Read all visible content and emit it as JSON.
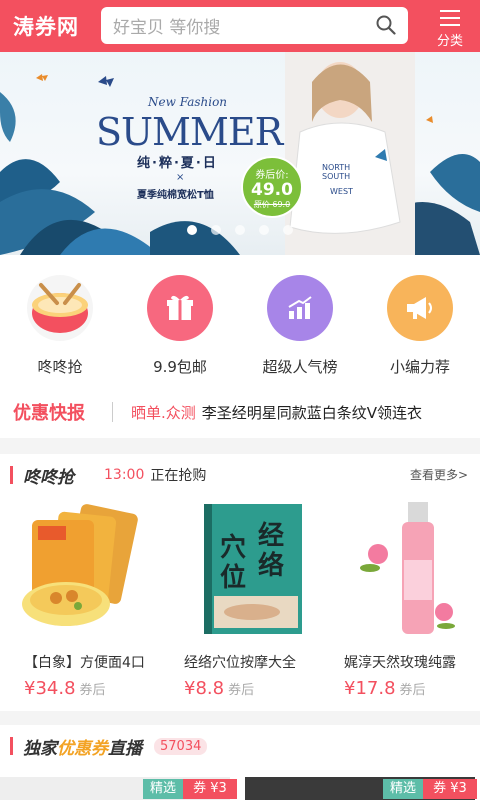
{
  "header": {
    "logo": "涛券网",
    "search_placeholder": "好宝贝 等你搜",
    "category_label": "分类"
  },
  "banner": {
    "new_fashion": "New Fashion",
    "summer": "SUMMER",
    "subtitle": "纯·粹·夏·日",
    "x_mark": "×",
    "description": "夏季纯棉宽松T恤",
    "badge_label": "券后价:",
    "badge_price": "49.0",
    "badge_original": "原价 69.0",
    "slide_count": 5,
    "active_slide": 0
  },
  "quick_links": [
    {
      "label": "咚咚抢",
      "icon": "drum-icon",
      "color": "#f5f5f5"
    },
    {
      "label": "9.9包邮",
      "icon": "gift-icon",
      "color": "#f7687f"
    },
    {
      "label": "超级人气榜",
      "icon": "chart-rise-icon",
      "color": "#a785e8"
    },
    {
      "label": "小编力荐",
      "icon": "megaphone-icon",
      "color": "#f8b45a"
    }
  ],
  "news": {
    "title": "优惠快报",
    "tag": "晒单.众测",
    "text": "李圣经明星同款蓝白条纹V领连衣"
  },
  "flash": {
    "title": "咚咚抢",
    "time": "13:00",
    "status": "正在抢购",
    "more": "查看更多>",
    "products": [
      {
        "name": "【白象】方便面4口",
        "price": "¥34.8",
        "after": "券后"
      },
      {
        "name": "经络穴位按摩大全",
        "price": "¥8.8",
        "after": "券后"
      },
      {
        "name": "娓淳天然玫瑰纯露",
        "price": "¥17.8",
        "after": "券后"
      }
    ]
  },
  "live": {
    "title_prefix": "独家",
    "title_highlight": "优惠券",
    "title_suffix": "直播",
    "count": "57034",
    "cards": [
      {
        "tag": "精选",
        "coupon": "券 ¥3"
      },
      {
        "tag": "精选",
        "coupon": "券 ¥3"
      }
    ]
  },
  "colors": {
    "brand": "#f3505f",
    "badge": "#7cbf3a"
  }
}
